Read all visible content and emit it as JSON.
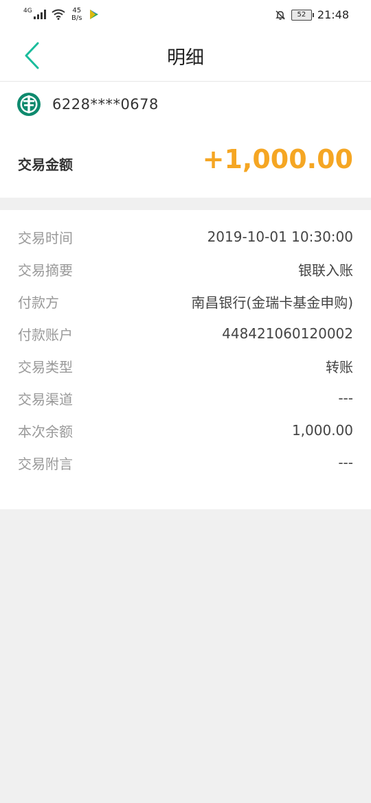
{
  "status_bar": {
    "network": "4G",
    "speed_value": "45",
    "speed_unit": "B/s",
    "battery": "52",
    "time": "21:48"
  },
  "nav": {
    "title": "明细"
  },
  "card": {
    "number": "6228****0678"
  },
  "amount": {
    "label": "交易金额",
    "value": "+1,000.00"
  },
  "details": [
    {
      "label": "交易时间",
      "value": "2019-10-01 10:30:00"
    },
    {
      "label": "交易摘要",
      "value": "银联入账"
    },
    {
      "label": "付款方",
      "value": "南昌银行(金瑞卡基金申购)"
    },
    {
      "label": "付款账户",
      "value": "448421060120002"
    },
    {
      "label": "交易类型",
      "value": "转账"
    },
    {
      "label": "交易渠道",
      "value": "---"
    },
    {
      "label": "本次余额",
      "value": "1,000.00"
    },
    {
      "label": "交易附言",
      "value": "---"
    }
  ],
  "colors": {
    "accent": "#1abc9c",
    "amount": "#f5a623",
    "bank_logo": "#0e8a6e"
  }
}
